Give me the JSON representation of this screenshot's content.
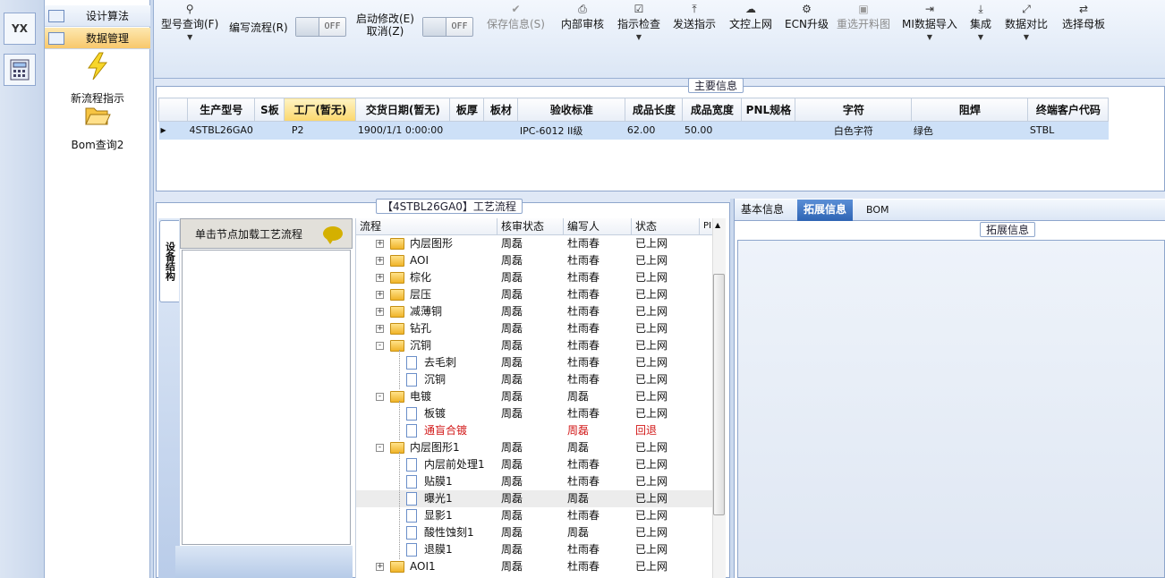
{
  "rail": {
    "logo_text": "YX"
  },
  "menu": {
    "items": [
      {
        "label": "设计算法"
      },
      {
        "label": "数据管理"
      }
    ],
    "buttons": [
      {
        "label": "新流程指示"
      },
      {
        "label": "Bom查询2"
      }
    ]
  },
  "toolbar": {
    "model_query": "型号查询(F)",
    "write_flow": "编写流程(R)",
    "write_flow_toggle": "OFF",
    "start_modify_line1": "启动修改(E)",
    "start_modify_line2": "取消(Z)",
    "start_modify_toggle": "OFF",
    "save_info": "保存信息(S)",
    "internal_review": "内部审核",
    "instruction_check": "指示检查",
    "send_instruction": "发送指示",
    "doc_online": "文控上网",
    "ecn_upgrade": "ECN升级",
    "reselect_image": "重选开料图",
    "mi_import": "MI数据导入",
    "integrate": "集成",
    "data_compare": "数据对比",
    "select_motherboard": "选择母板"
  },
  "main_info": {
    "title": "主要信息",
    "columns": [
      "生产型号",
      "S板",
      "工厂(暂无)",
      "交货日期(暂无)",
      "板厚",
      "板材",
      "验收标准",
      "成品长度",
      "成品宽度",
      "PNL规格",
      "字符",
      "阻焊",
      "终端客户代码"
    ],
    "row": {
      "model": "4STBL26GA0",
      "s_board": "",
      "factory": "P2",
      "delivery": "1900/1/1 0:00:00",
      "thickness": "",
      "material": "",
      "standard": "IPC-6012 II级",
      "length": "62.00",
      "width": "50.00",
      "pnl": "",
      "character": "白色字符",
      "solder_mask": "绿色",
      "customer_code": "STBL"
    }
  },
  "flow": {
    "title": "【4STBL26GA0】工艺流程",
    "side_tab": "设备结构",
    "node_hint": "单击节点加载工艺流程",
    "columns": [
      "流程",
      "核审状态",
      "编写人",
      "状态",
      "PI"
    ],
    "rows": [
      {
        "name": "内层图形",
        "review": "周磊",
        "writer": "杜雨春",
        "status": "已上网"
      },
      {
        "name": "AOI",
        "review": "周磊",
        "writer": "杜雨春",
        "status": "已上网"
      },
      {
        "name": "棕化",
        "review": "周磊",
        "writer": "杜雨春",
        "status": "已上网"
      },
      {
        "name": "层压",
        "review": "周磊",
        "writer": "杜雨春",
        "status": "已上网"
      },
      {
        "name": "减薄铜",
        "review": "周磊",
        "writer": "杜雨春",
        "status": "已上网"
      },
      {
        "name": "钻孔",
        "review": "周磊",
        "writer": "杜雨春",
        "status": "已上网"
      },
      {
        "name": "沉铜",
        "review": "周磊",
        "writer": "杜雨春",
        "status": "已上网"
      },
      {
        "name": "去毛刺",
        "review": "周磊",
        "writer": "杜雨春",
        "status": "已上网"
      },
      {
        "name": "沉铜",
        "review": "周磊",
        "writer": "杜雨春",
        "status": "已上网"
      },
      {
        "name": "电镀",
        "review": "周磊",
        "writer": "周磊",
        "status": "已上网"
      },
      {
        "name": "板镀",
        "review": "周磊",
        "writer": "杜雨春",
        "status": "已上网"
      },
      {
        "name": "通盲合镀",
        "review": "",
        "writer": "周磊",
        "status": "回退"
      },
      {
        "name": "内层图形1",
        "review": "周磊",
        "writer": "周磊",
        "status": "已上网"
      },
      {
        "name": "内层前处理1",
        "review": "周磊",
        "writer": "杜雨春",
        "status": "已上网"
      },
      {
        "name": "贴膜1",
        "review": "周磊",
        "writer": "杜雨春",
        "status": "已上网"
      },
      {
        "name": "曝光1",
        "review": "周磊",
        "writer": "周磊",
        "status": "已上网"
      },
      {
        "name": "显影1",
        "review": "周磊",
        "writer": "杜雨春",
        "status": "已上网"
      },
      {
        "name": "酸性蚀刻1",
        "review": "周磊",
        "writer": "周磊",
        "status": "已上网"
      },
      {
        "name": "退膜1",
        "review": "周磊",
        "writer": "杜雨春",
        "status": "已上网"
      },
      {
        "name": "AOI1",
        "review": "周磊",
        "writer": "杜雨春",
        "status": "已上网"
      }
    ]
  },
  "right": {
    "tabs": [
      "基本信息",
      "拓展信息",
      "BOM"
    ],
    "ext_title": "拓展信息"
  }
}
